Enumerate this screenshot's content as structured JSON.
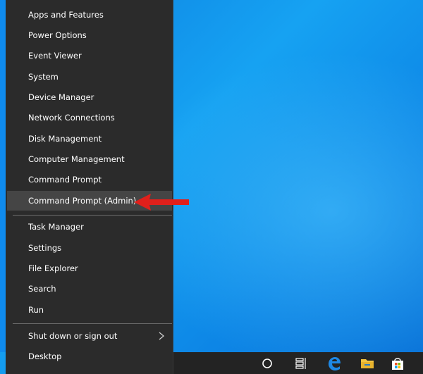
{
  "menu": {
    "group1": [
      {
        "label": "Apps and Features",
        "name": "menu-item-apps-and-features"
      },
      {
        "label": "Power Options",
        "name": "menu-item-power-options"
      },
      {
        "label": "Event Viewer",
        "name": "menu-item-event-viewer"
      },
      {
        "label": "System",
        "name": "menu-item-system"
      },
      {
        "label": "Device Manager",
        "name": "menu-item-device-manager"
      },
      {
        "label": "Network Connections",
        "name": "menu-item-network-connections"
      },
      {
        "label": "Disk Management",
        "name": "menu-item-disk-management"
      },
      {
        "label": "Computer Management",
        "name": "menu-item-computer-management"
      },
      {
        "label": "Command Prompt",
        "name": "menu-item-command-prompt"
      },
      {
        "label": "Command Prompt (Admin)",
        "name": "menu-item-command-prompt-admin"
      }
    ],
    "group2": [
      {
        "label": "Task Manager",
        "name": "menu-item-task-manager"
      },
      {
        "label": "Settings",
        "name": "menu-item-settings"
      },
      {
        "label": "File Explorer",
        "name": "menu-item-file-explorer"
      },
      {
        "label": "Search",
        "name": "menu-item-search"
      },
      {
        "label": "Run",
        "name": "menu-item-run"
      }
    ],
    "group3": [
      {
        "label": "Shut down or sign out",
        "name": "menu-item-shut-down-or-sign-out",
        "has_submenu": true
      },
      {
        "label": "Desktop",
        "name": "menu-item-desktop"
      }
    ],
    "highlighted": "Command Prompt (Admin)"
  },
  "annotation": {
    "arrow_color": "#e0201b",
    "points_to": "Command Prompt (Admin)"
  },
  "taskbar": {
    "icons": [
      "cortana-circle-icon",
      "task-view-icon",
      "edge-icon",
      "file-explorer-icon",
      "store-icon"
    ]
  },
  "colors": {
    "menu_bg": "#2b2b2b",
    "menu_highlight": "#454545",
    "taskbar_bg": "#232323",
    "desktop_blue": "#0c7fe0"
  }
}
